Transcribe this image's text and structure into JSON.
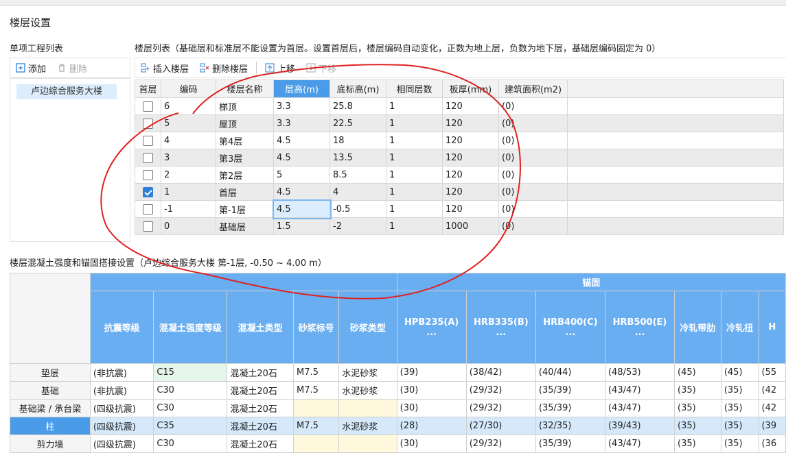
{
  "window_title": "楼层设置",
  "left_panel": {
    "header": "单项工程列表",
    "add_label": "添加",
    "delete_label": "删除",
    "projects": [
      "卢边综合服务大楼"
    ]
  },
  "floor_list": {
    "header": "楼层列表（基础层和标准层不能设置为首层。设置首层后，楼层编码自动变化，正数为地上层，负数为地下层，基础层编码固定为 0）",
    "toolbar": {
      "insert": "插入楼层",
      "delete": "删除楼层",
      "up": "上移",
      "down": "下移"
    },
    "columns": [
      "首层",
      "编码",
      "楼层名称",
      "层高(m)",
      "底标高(m)",
      "相同层数",
      "板厚(mm)",
      "建筑面积(m2)"
    ],
    "rows": [
      {
        "first": false,
        "code": "6",
        "name": "梯顶",
        "height": "3.3",
        "bottom": "25.8",
        "same": "1",
        "thick": "120",
        "area": "(0)"
      },
      {
        "first": false,
        "code": "5",
        "name": "屋顶",
        "height": "3.3",
        "bottom": "22.5",
        "same": "1",
        "thick": "120",
        "area": "(0)"
      },
      {
        "first": false,
        "code": "4",
        "name": "第4层",
        "height": "4.5",
        "bottom": "18",
        "same": "1",
        "thick": "120",
        "area": "(0)"
      },
      {
        "first": false,
        "code": "3",
        "name": "第3层",
        "height": "4.5",
        "bottom": "13.5",
        "same": "1",
        "thick": "120",
        "area": "(0)"
      },
      {
        "first": false,
        "code": "2",
        "name": "第2层",
        "height": "5",
        "bottom": "8.5",
        "same": "1",
        "thick": "120",
        "area": "(0)"
      },
      {
        "first": true,
        "code": "1",
        "name": "首层",
        "height": "4.5",
        "bottom": "4",
        "same": "1",
        "thick": "120",
        "area": "(0)"
      },
      {
        "first": false,
        "code": "-1",
        "name": "第-1层",
        "height": "4.5",
        "bottom": "-0.5",
        "same": "1",
        "thick": "120",
        "area": "(0)"
      },
      {
        "first": false,
        "code": "0",
        "name": "基础层",
        "height": "1.5",
        "bottom": "-2",
        "same": "1",
        "thick": "1000",
        "area": "(0)"
      }
    ]
  },
  "concrete": {
    "header": "楼层混凝土强度和锚固搭接设置（卢边综合服务大楼  第-1层, -0.50 ~ 4.00 m）",
    "anchor_group": "锚固",
    "columns": [
      "抗震等级",
      "混凝土强度等级",
      "混凝土类型",
      "砂浆标号",
      "砂浆类型",
      "HPB235(A)\n...",
      "HRB335(B)\n...",
      "HRB400(C)\n...",
      "HRB500(E)\n...",
      "冷轧带肋",
      "冷轧扭",
      "H"
    ],
    "rows": [
      {
        "name": "垫层",
        "cells": [
          "(非抗震)",
          "C15",
          "混凝土20石",
          "M7.5",
          "水泥砂浆",
          "(39)",
          "(38/42)",
          "(40/44)",
          "(48/53)",
          "(45)",
          "(45)",
          "(55"
        ]
      },
      {
        "name": "基础",
        "cells": [
          "(非抗震)",
          "C30",
          "混凝土20石",
          "M7.5",
          "水泥砂浆",
          "(30)",
          "(29/32)",
          "(35/39)",
          "(43/47)",
          "(35)",
          "(35)",
          "(42"
        ]
      },
      {
        "name": "基础梁 / 承台梁",
        "cells": [
          "(四级抗震)",
          "C30",
          "混凝土20石",
          "",
          "",
          "(30)",
          "(29/32)",
          "(35/39)",
          "(43/47)",
          "(35)",
          "(35)",
          "(42"
        ]
      },
      {
        "name": "柱",
        "cells": [
          "(四级抗震)",
          "C35",
          "混凝土20石",
          "M7.5",
          "水泥砂浆",
          "(28)",
          "(27/30)",
          "(32/35)",
          "(39/43)",
          "(35)",
          "(35)",
          "(39"
        ]
      },
      {
        "name": "剪力墙",
        "cells": [
          "(四级抗震)",
          "C30",
          "混凝土20石",
          "",
          "",
          "(30)",
          "(29/32)",
          "(35/39)",
          "(43/47)",
          "(35)",
          "(35)",
          "(36"
        ]
      }
    ]
  }
}
